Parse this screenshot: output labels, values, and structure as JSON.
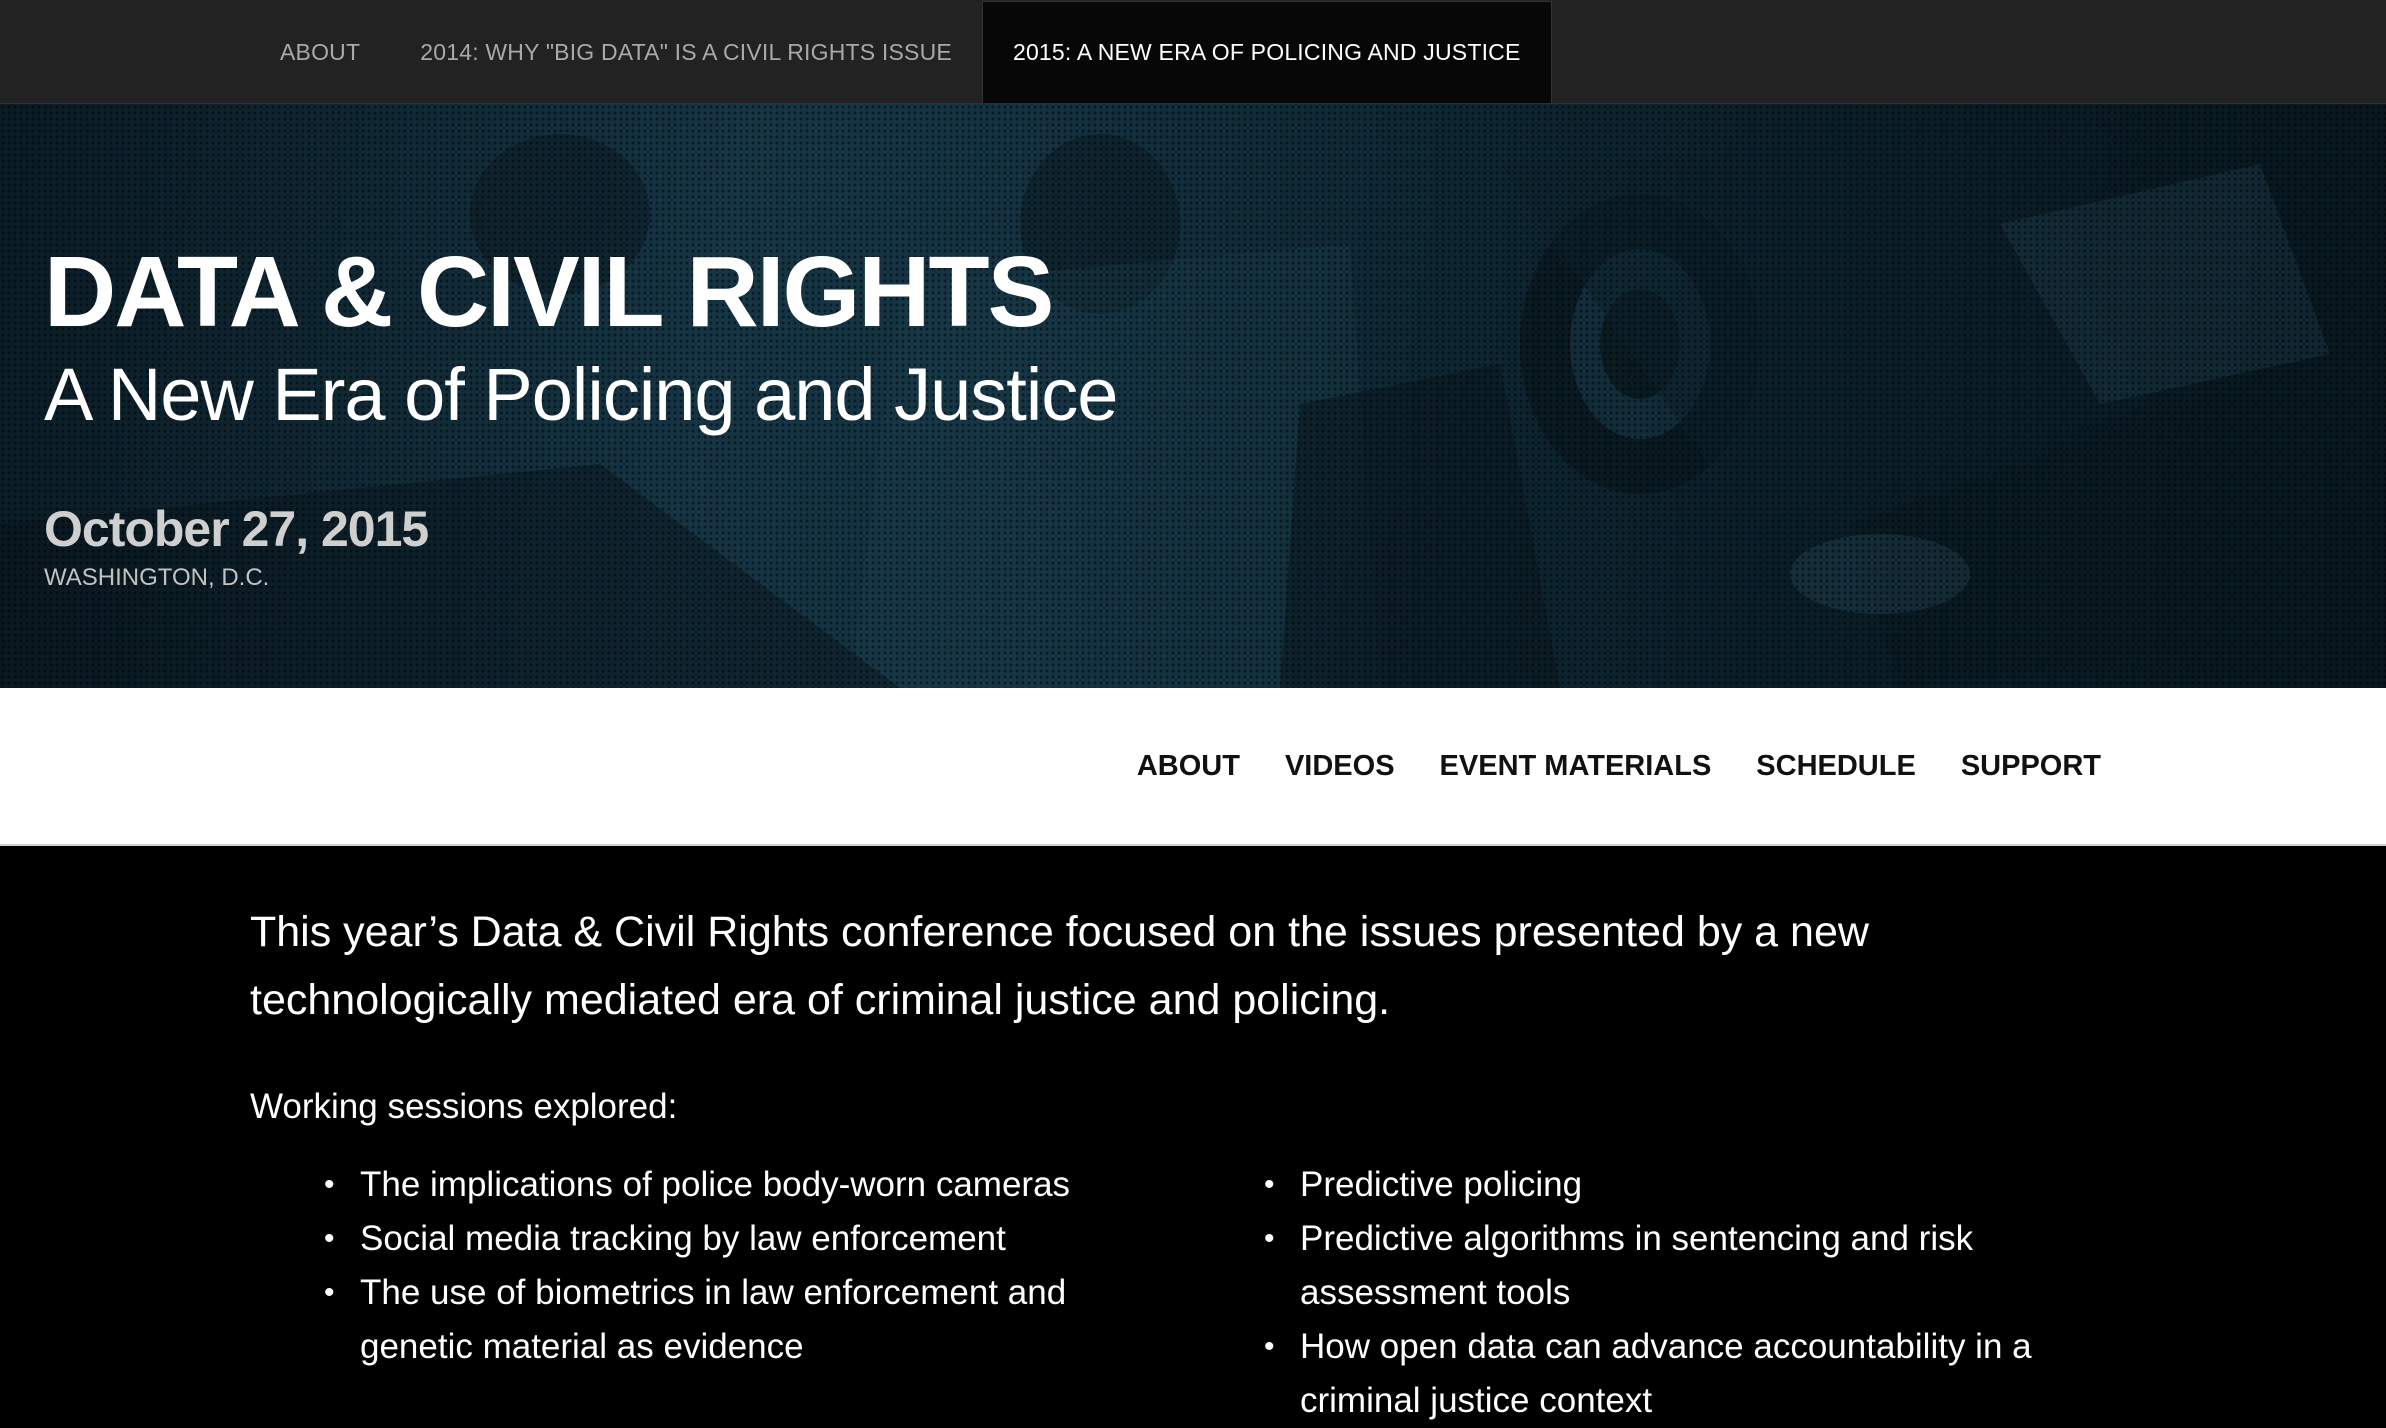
{
  "top_nav": {
    "items": [
      {
        "label": "ABOUT",
        "active": false
      },
      {
        "label": "2014: WHY \"BIG DATA\" IS A CIVIL RIGHTS ISSUE",
        "active": false
      },
      {
        "label": "2015: A NEW ERA OF POLICING AND JUSTICE",
        "active": true
      }
    ]
  },
  "hero": {
    "title": "DATA & CIVIL RIGHTS",
    "subtitle": "A New Era of Policing and Justice",
    "date": "October 27, 2015",
    "location": "WASHINGTON, D.C."
  },
  "section_nav": {
    "items": [
      "ABOUT",
      "VIDEOS",
      "EVENT MATERIALS",
      "SCHEDULE",
      "SUPPORT"
    ]
  },
  "main": {
    "intro": "This year’s Data & Civil Rights conference focused on the issues presented by a new technologically mediated era of criminal justice and policing.",
    "sessions_label": "Working sessions explored:",
    "sessions_left": [
      "The implications of police body-worn cameras",
      "Social media tracking by law enforcement",
      "The use of biometrics in law enforcement and genetic material as evidence"
    ],
    "sessions_right": [
      "Predictive policing",
      "Predictive algorithms in sentencing and risk assessment tools",
      "How open data can advance accountability in a criminal justice context"
    ]
  },
  "colors": {
    "top_nav_bg": "#222222",
    "top_nav_active_bg": "#070707",
    "hero_tint": "#183b4c",
    "section_nav_bg": "#ffffff",
    "content_bg": "#000000"
  }
}
